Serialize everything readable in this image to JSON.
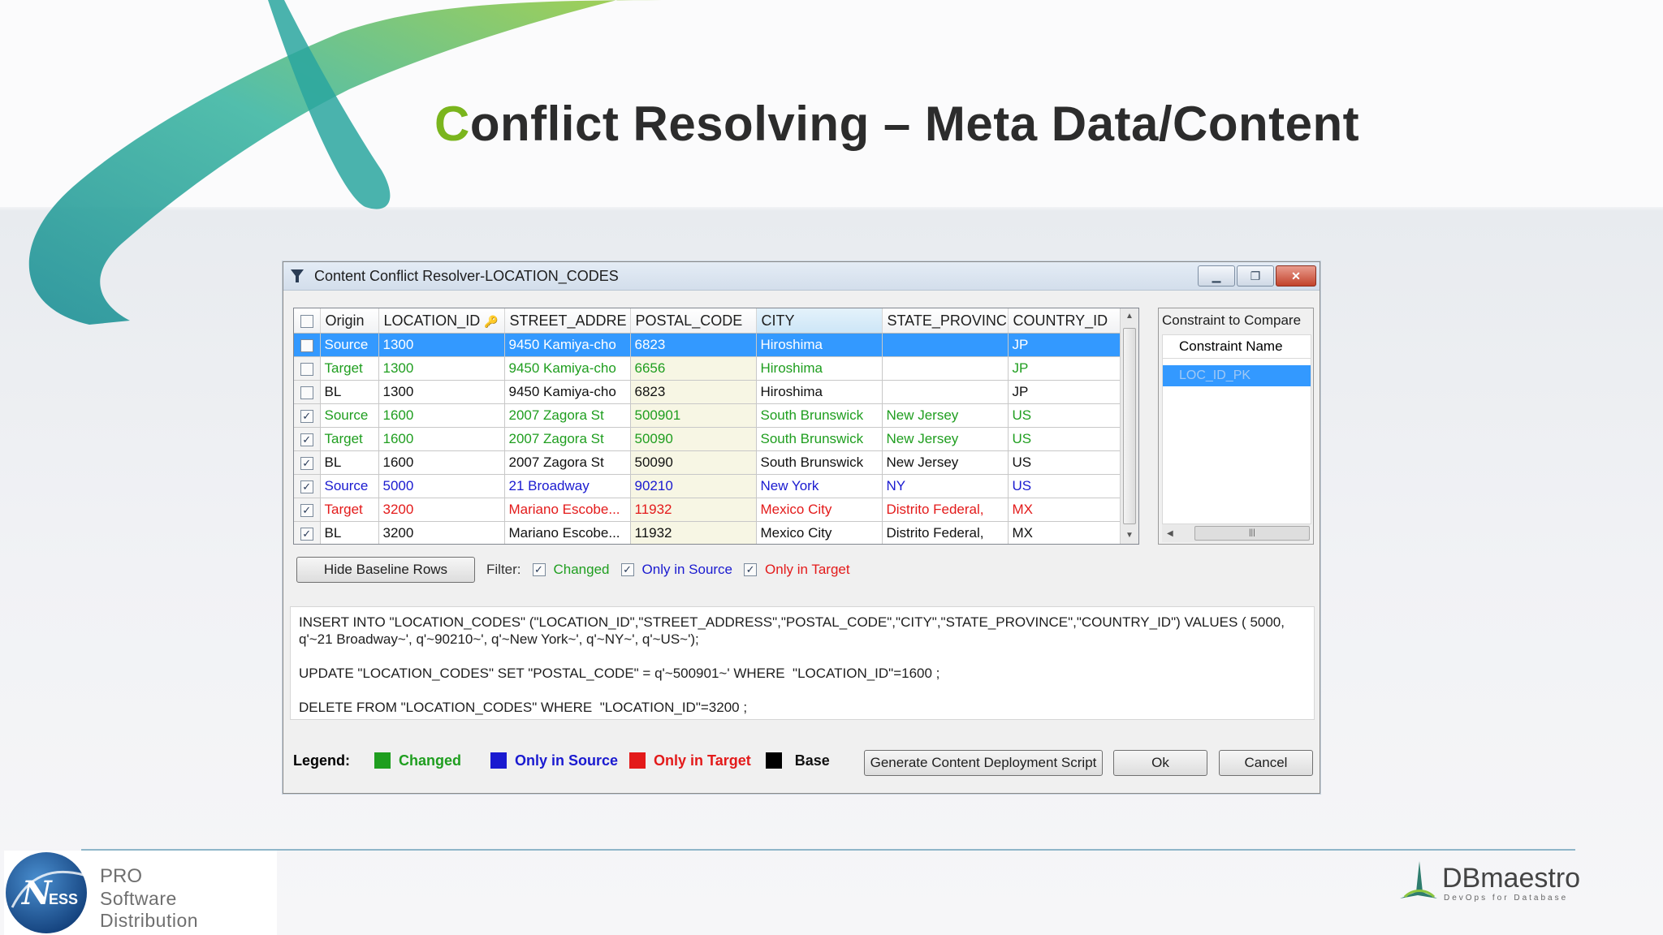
{
  "slide": {
    "title_first": "C",
    "title_rest": "onflict Resolving – Meta Data/Content",
    "colors": {
      "title_accent": "#7ab51d",
      "selection": "#3399ff"
    }
  },
  "window": {
    "title": "Content Conflict Resolver-LOCATION_CODES",
    "controls": {
      "minimize": "minimize-icon",
      "restore": "restore-icon",
      "close": "close-icon"
    }
  },
  "grid": {
    "columns": [
      "Origin",
      "LOCATION_ID",
      "STREET_ADDRE",
      "POSTAL_CODE",
      "CITY",
      "STATE_PROVINC",
      "COUNTRY_ID"
    ],
    "rows": [
      {
        "checked": false,
        "kind": "sel",
        "origin": "Source",
        "location_id": "1300",
        "street": "9450 Kamiya-cho",
        "postal": "6823",
        "city": "Hiroshima",
        "state": "",
        "country": "JP"
      },
      {
        "checked": false,
        "kind": "g",
        "origin": "Target",
        "location_id": "1300",
        "street": "9450 Kamiya-cho",
        "postal": "6656",
        "city": "Hiroshima",
        "state": "",
        "country": "JP"
      },
      {
        "checked": false,
        "kind": "k",
        "origin": "BL",
        "location_id": "1300",
        "street": "9450 Kamiya-cho",
        "postal": "6823",
        "city": "Hiroshima",
        "state": "",
        "country": "JP"
      },
      {
        "checked": true,
        "kind": "g",
        "origin": "Source",
        "location_id": "1600",
        "street": "2007 Zagora St",
        "postal": "500901",
        "city": "South Brunswick",
        "state": "New Jersey",
        "country": "US"
      },
      {
        "checked": true,
        "kind": "g",
        "origin": "Target",
        "location_id": "1600",
        "street": "2007 Zagora St",
        "postal": "50090",
        "city": "South Brunswick",
        "state": "New Jersey",
        "country": "US"
      },
      {
        "checked": true,
        "kind": "k",
        "origin": "BL",
        "location_id": "1600",
        "street": "2007 Zagora St",
        "postal": "50090",
        "city": "South Brunswick",
        "state": "New Jersey",
        "country": "US"
      },
      {
        "checked": true,
        "kind": "b",
        "origin": "Source",
        "location_id": "5000",
        "street": "21 Broadway",
        "postal": "90210",
        "city": "New York",
        "state": "NY",
        "country": "US"
      },
      {
        "checked": true,
        "kind": "r",
        "origin": "Target",
        "location_id": "3200",
        "street": "Mariano Escobe...",
        "postal": "11932",
        "city": "Mexico City",
        "state": "Distrito Federal,",
        "country": "MX"
      },
      {
        "checked": true,
        "kind": "k",
        "origin": "BL",
        "location_id": "3200",
        "street": "Mariano Escobe...",
        "postal": "11932",
        "city": "Mexico City",
        "state": "Distrito Federal,",
        "country": "MX"
      }
    ]
  },
  "side_panel": {
    "label": "Constraint to Compare",
    "column": "Constraint Name",
    "selected": "LOC_ID_PK"
  },
  "filter": {
    "hide_button": "Hide Baseline Rows",
    "label": "Filter:",
    "changed": "Changed",
    "only_source": "Only in Source",
    "only_target": "Only in Target"
  },
  "sql": {
    "insert": "INSERT INTO \"LOCATION_CODES\" (\"LOCATION_ID\",\"STREET_ADDRESS\",\"POSTAL_CODE\",\"CITY\",\"STATE_PROVINCE\",\"COUNTRY_ID\") VALUES ( 5000, q'~21 Broadway~', q'~90210~', q'~New York~', q'~NY~', q'~US~');",
    "update": "UPDATE \"LOCATION_CODES\" SET \"POSTAL_CODE\" = q'~500901~' WHERE  \"LOCATION_ID\"=1600 ;",
    "delete": "DELETE FROM \"LOCATION_CODES\" WHERE  \"LOCATION_ID\"=3200 ;"
  },
  "legend": {
    "label": "Legend:",
    "changed": "Changed",
    "only_source": "Only in Source",
    "only_target": "Only in Target",
    "base": "Base",
    "colors": {
      "changed": "#1f9e1f",
      "only_source": "#1a1ad0",
      "only_target": "#e31a1a",
      "base": "#000000"
    }
  },
  "buttons": {
    "generate": "Generate Content Deployment Script",
    "ok": "Ok",
    "cancel": "Cancel"
  },
  "footer": {
    "ness_logo_text": "ESS",
    "ness_line1": "PRO",
    "ness_line2": "Software Distribution",
    "dbm_name": "DBmaestro",
    "dbm_tagline": "DevOps for Database"
  }
}
